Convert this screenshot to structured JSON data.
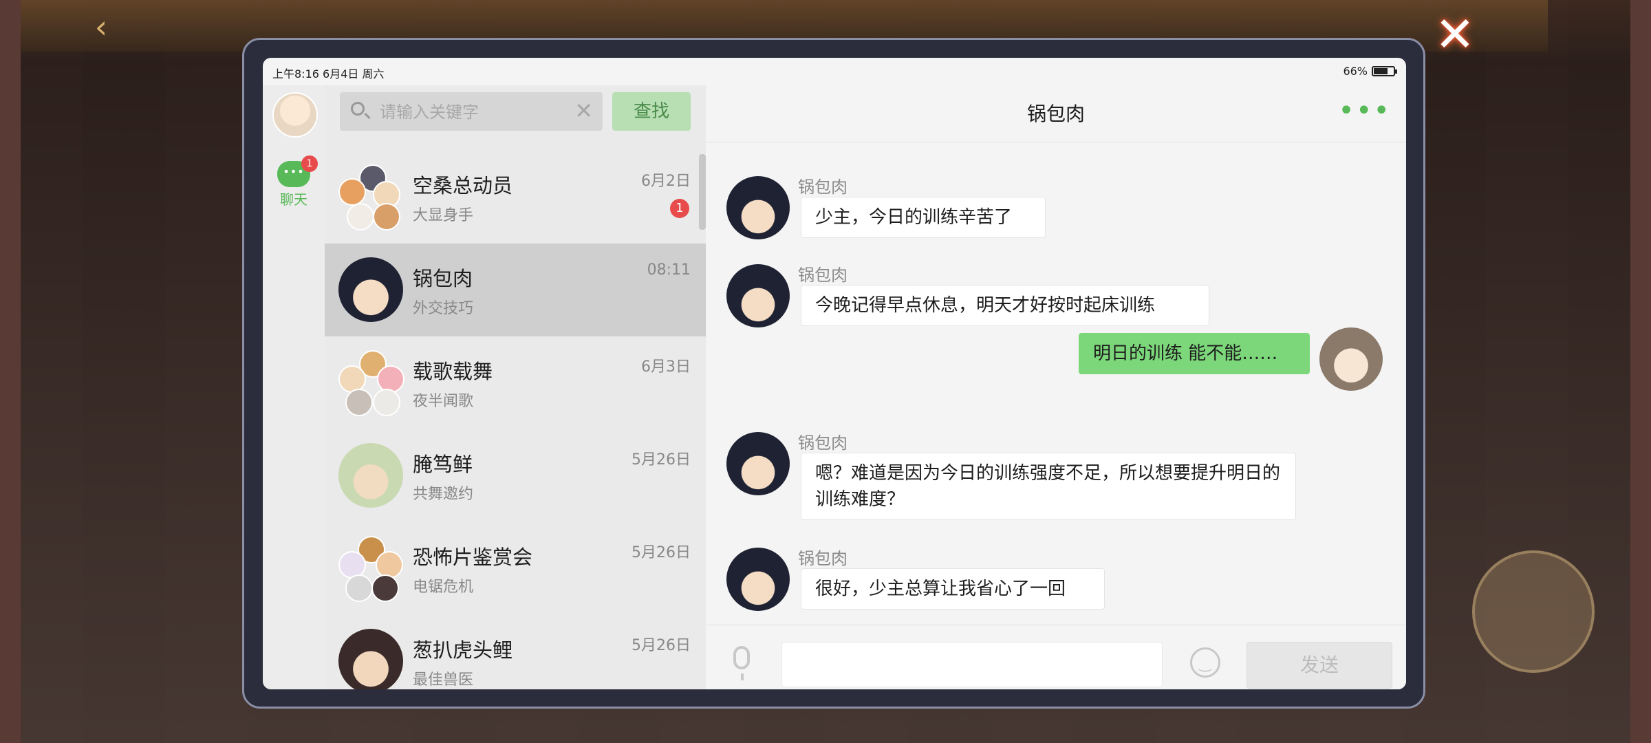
{
  "status_bar": {
    "time_date": "上午8:16  6月4日  周六",
    "battery": "66%"
  },
  "sidebar": {
    "chat_label": "聊天",
    "chat_badge": "1"
  },
  "search": {
    "placeholder": "请输入关键字",
    "button": "查找"
  },
  "contacts": [
    {
      "name": "空桑总动员",
      "subtitle": "大显身手",
      "time": "6月2日",
      "unread": "1"
    },
    {
      "name": "锅包肉",
      "subtitle": "外交技巧",
      "time": "08:11"
    },
    {
      "name": "载歌载舞",
      "subtitle": "夜半闻歌",
      "time": "6月3日"
    },
    {
      "name": "腌笃鲜",
      "subtitle": "共舞邀约",
      "time": "5月26日"
    },
    {
      "name": "恐怖片鉴赏会",
      "subtitle": "电锯危机",
      "time": "5月26日"
    },
    {
      "name": "葱扒虎头鲤",
      "subtitle": "最佳兽医",
      "time": "5月26日"
    }
  ],
  "chat": {
    "title": "锅包肉",
    "messages": [
      {
        "sender": "锅包肉",
        "text": "少主，今日的训练辛苦了"
      },
      {
        "sender": "锅包肉",
        "text": "今晚记得早点休息，明天才好按时起床训练"
      },
      {
        "sender": "me",
        "text": "明日的训练 能不能……"
      },
      {
        "sender": "锅包肉",
        "text": "嗯？难道是因为今日的训练强度不足，所以想要提升明日的训练难度？"
      },
      {
        "sender": "锅包肉",
        "text": "很好，少主总算让我省心了一回"
      }
    ]
  },
  "composer": {
    "send": "发送"
  }
}
